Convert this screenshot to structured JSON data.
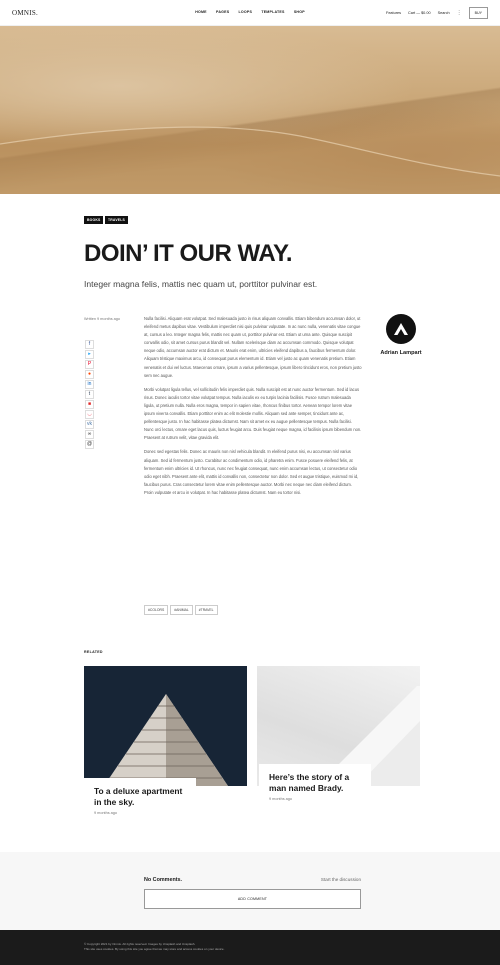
{
  "header": {
    "logo": "OMNIS.",
    "nav": [
      "HOME",
      "PAGES",
      "LOOPS",
      "TEMPLATES",
      "SHOP"
    ],
    "features_label": "Features",
    "cart_label": "Cart — $0.00",
    "search_label": "Search",
    "buy_label": "BUY"
  },
  "article": {
    "tags": [
      "BOOKS",
      "TRAVELS"
    ],
    "title": "DOIN’ IT OUR WAY.",
    "subtitle": "Integer magna felis, mattis nec quam ut, porttitor pulvinar est.",
    "written": "Written 9 months ago",
    "share_icons": [
      "facebook-icon",
      "twitter-icon",
      "pinterest-icon",
      "reddit-icon",
      "linkedin-icon",
      "tumblr-icon",
      "flipboard-icon",
      "pocket-icon",
      "vk-icon",
      "link-icon",
      "email-icon"
    ],
    "paragraphs": [
      "Nulla facilisi. Aliquam erat volutpat. Sed malesuada justo in risus aliquam convallis. Etiam bibendum accumsan dolor, ut eleifend metus dapibus vitae. Vestibulum imperdiet nisi quis pulvinar vulputate. In ac nunc nulla, venenatis vitae congue at, cursus a leo. Integer magna felis, mattis nec quam ut, porttitor pulvinar est. Etiam ut urna ante. Quisque suscipit convallis odio, sit amet cursus purus blandit vel. Nullam scelerisque diam ac accumsan commodo. Quisque volutpat neque odio, accumsan auctor erat dictum et. Mauris erat enim, ultricies eleifend dapibus a, faucibus fermentum dolor. Aliquam tristique maximus arcu, id consequat purus elementum id. Etiam vel justo ac quam venenatis pretium. Etiam venenatis et dui vel luctus. Maecenas ornare, ipsum a varius pellentesque, ipsum libero tincidunt eros, non pretium justo sem nec augue.",
      "Morbi volutpat ligula tellus, vel sollicitudin felis imperdiet quis. Nulla suscipit est at nunc auctor fermentum. Sed id lacus risus. Donec iaculis tortor vitae volutpat tempus. Nulla iaculis ex eu turpis lacinia facilisis. Fusce rutrum malesuada ligula, ut pretium nulla. Nulla eros magna, tempor in sapien vitae, rhoncus finibus tortor. Aenean tempor lorem vitae ipsum viverra convallis. Etiam porttitor enim ac elit molestie mollis. Aliquam sed ante semper, tincidunt ante ac, pellentesque justo. In hac habitasse platea dictumst. Nam sit amet ex eu augue pellentesque tempus. Nulla facilisi. Nunc orci lectus, ornare eget lacus quis, luctus feugiat arcu. Duis feugiat neque magna, id facilisis ipsum bibendum non. Praesent at rutrum velit, vitae gravida elit.",
      "Donec sed egestas felis. Donec ac mauris non nisl vehicula blandit. In eleifend purus nisi, eu accumsan nisl varius aliquam. Sed id fermentum justo. Curabitur ac condimentum odio, id pharetra enim. Fusce posuere eleifend felis, at fermentum enim ultricies id. Ut rhoncus, nunc nec feugiat consequat, nunc enim accumsan lectus, ut consectetur odio odio eget nibh. Praesent ante elit, mattis id convallis non, consectetur non dolor. Sed et augue tristique, euismod mi id, faucibus purus. Cras consectetur lorem vitae enim pellentesque auctor. Morbi nec neque nec diam eleifend dictum. Proin vulputate et arcu in volutpat. In hac habitasse platea dictumst. Nam eu tortor nisi."
    ],
    "post_tags": [
      "#COLORS",
      "#ANIMAL",
      "#TRAVEL"
    ]
  },
  "author": {
    "name": "Adrian Lampart"
  },
  "related": {
    "label": "RELATED",
    "cards": [
      {
        "title": "To a deluxe apartment in the sky.",
        "date": "9 months ago"
      },
      {
        "title": "Here’s the story of a man named Brady.",
        "date": "9 months ago"
      }
    ]
  },
  "comments": {
    "heading": "No Comments.",
    "start_label": "Start the discussion",
    "add_label": "ADD COMMENT"
  },
  "footer": {
    "line1": "© Copyright 2021 by Omnis. All rights reserved. Images by Unsplash and Unsplash.",
    "line2": "This site uses cookies. By using this site you agree that we may store and access cookies on your device."
  }
}
